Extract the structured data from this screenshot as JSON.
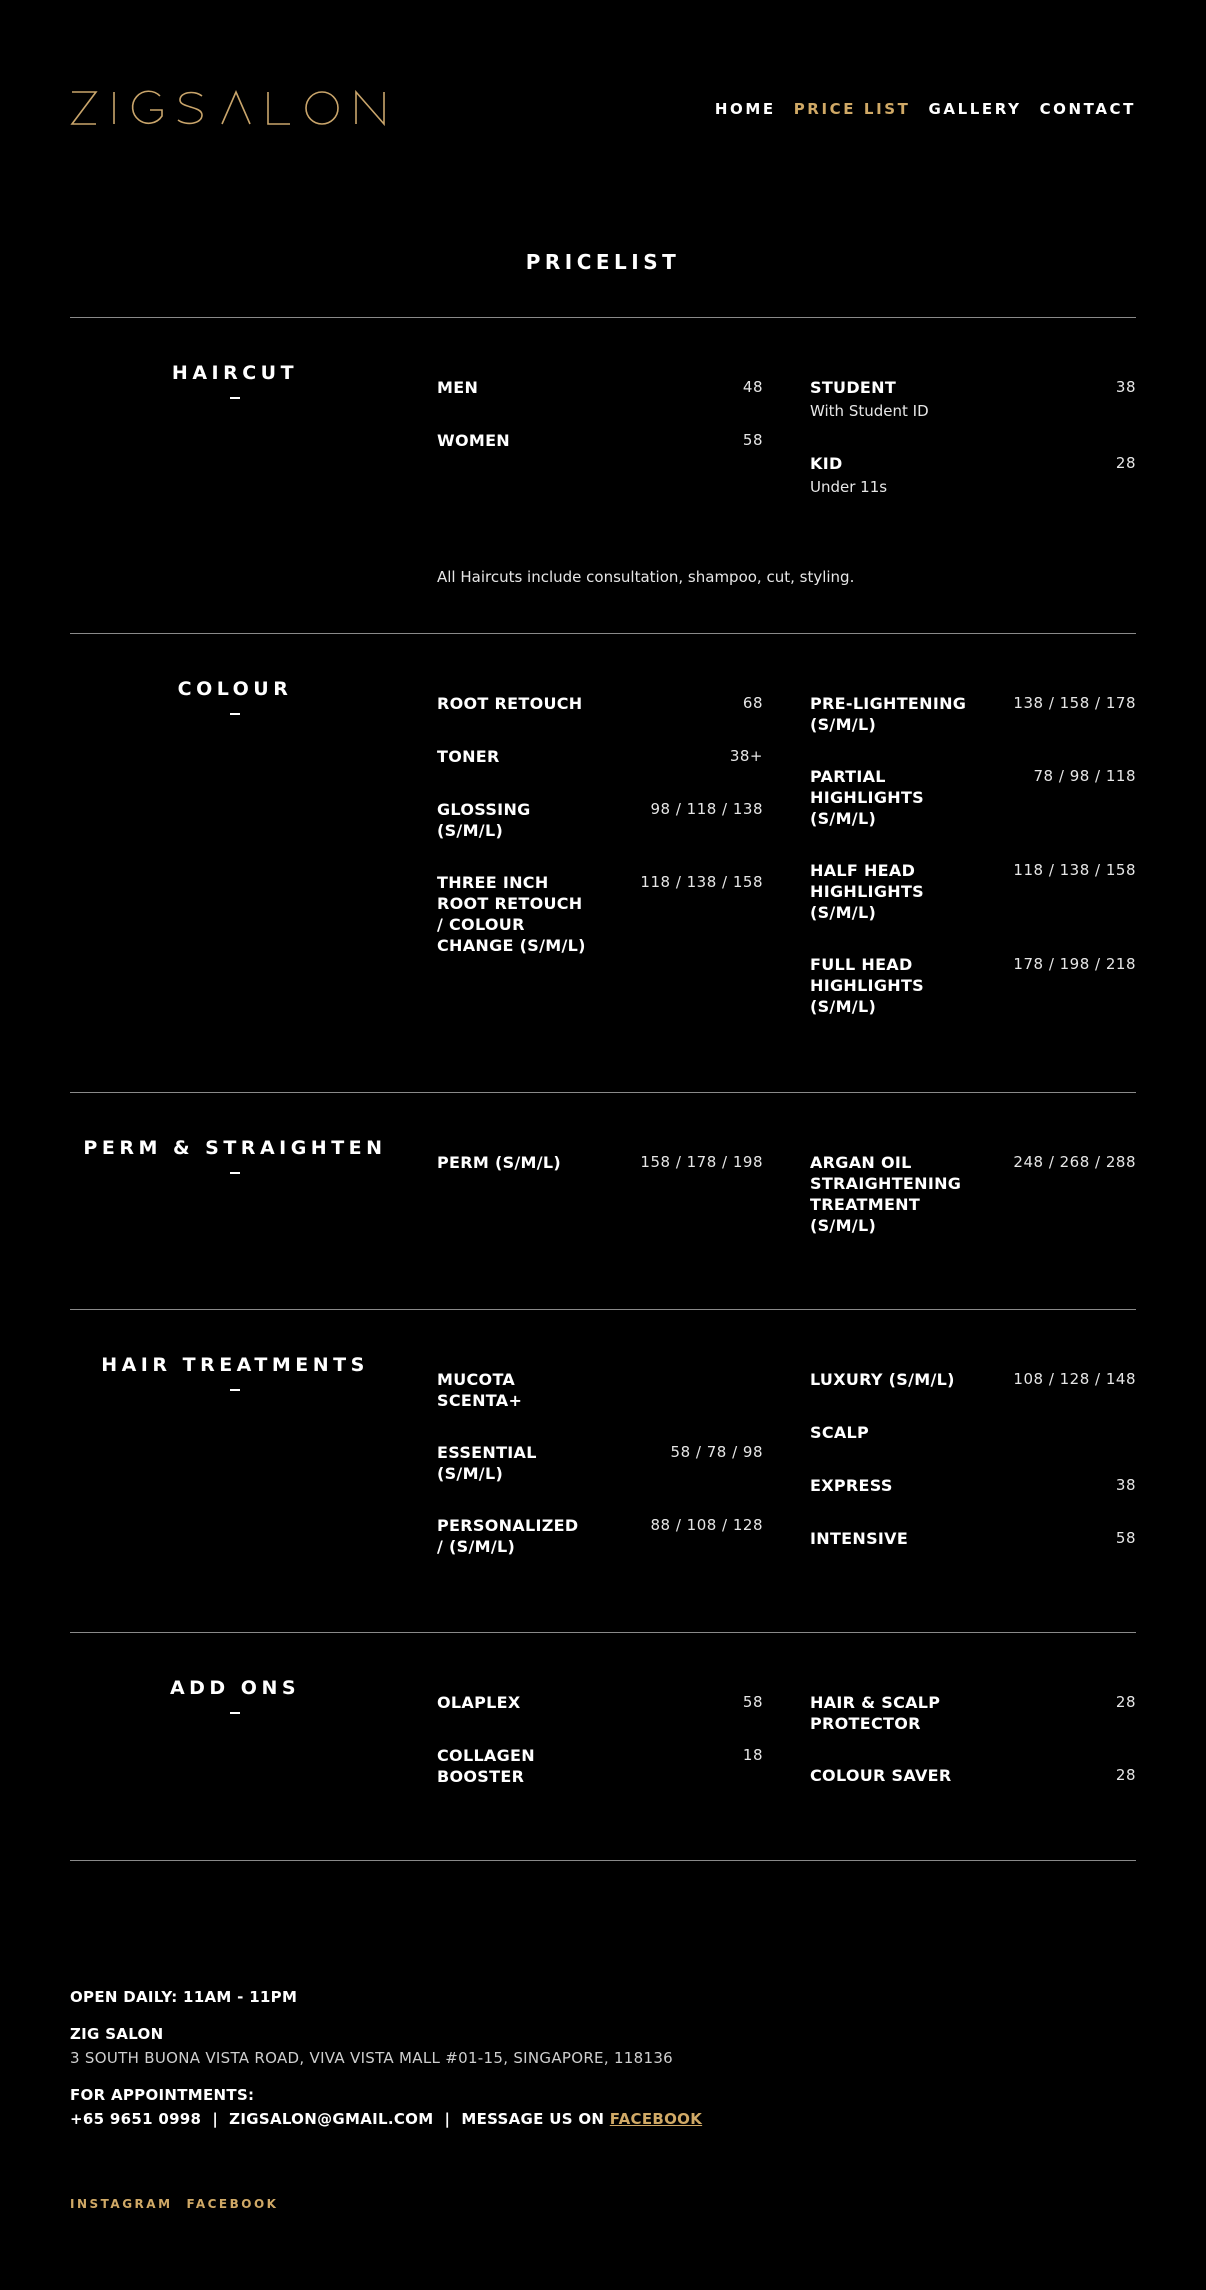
{
  "brand": {
    "logo_text": "ZIGSALON",
    "accent_color": "#d0a966"
  },
  "nav": {
    "items": [
      {
        "label": "HOME",
        "active": false
      },
      {
        "label": "PRICE LIST",
        "active": true
      },
      {
        "label": "GALLERY",
        "active": false
      },
      {
        "label": "CONTACT",
        "active": false
      }
    ]
  },
  "page": {
    "title": "PRICELIST"
  },
  "haircut": {
    "title": "HAIRCUT",
    "left": [
      {
        "name": "MEN",
        "price": "48"
      },
      {
        "name": "WOMEN",
        "price": "58"
      }
    ],
    "right": [
      {
        "name": "STUDENT",
        "price": "38",
        "sub": "With Student ID"
      },
      {
        "name": "KID",
        "price": "28",
        "sub": "Under 11s"
      }
    ],
    "note": "All Haircuts include consultation, shampoo, cut, styling."
  },
  "colour": {
    "title": "COLOUR",
    "left": [
      {
        "name": "ROOT RETOUCH",
        "price": "68"
      },
      {
        "name": "TONER",
        "price": "38+"
      },
      {
        "name": "GLOSSING\n(S/M/L)",
        "price": "98 / 118 / 138"
      },
      {
        "name": "THREE INCH\nROOT RETOUCH\n/ COLOUR\nCHANGE (S/M/L)",
        "price": "118 / 138 / 158"
      }
    ],
    "right": [
      {
        "name": "PRE-LIGHTENING\n(S/M/L)",
        "price": "138 / 158 / 178"
      },
      {
        "name": "PARTIAL\nHIGHLIGHTS\n(S/M/L)",
        "price": "78 / 98 / 118"
      },
      {
        "name": "HALF HEAD\nHIGHLIGHTS\n(S/M/L)",
        "price": "118 / 138 / 158"
      },
      {
        "name": "FULL HEAD\nHIGHLIGHTS\n(S/M/L)",
        "price": "178 / 198 / 218"
      }
    ]
  },
  "perm": {
    "title": "PERM & STRAIGHTEN",
    "left": [
      {
        "name": "PERM (S/M/L)",
        "price": "158 / 178 / 198"
      }
    ],
    "right": [
      {
        "name": "ARGAN OIL\nSTRAIGHTENING\nTREATMENT\n(S/M/L)",
        "price": "248 / 268 / 288"
      }
    ]
  },
  "treatments": {
    "title": "HAIR TREATMENTS",
    "left": [
      {
        "name": "MUCOTA\nSCENTA+",
        "price": ""
      },
      {
        "name": "ESSENTIAL\n(S/M/L)",
        "price": "58 / 78 / 98"
      },
      {
        "name": "PERSONALIZED\n/ (S/M/L)",
        "price": "88 / 108 / 128"
      }
    ],
    "right": [
      {
        "name": "LUXURY (S/M/L)",
        "price": "108 / 128 / 148"
      },
      {
        "name": "SCALP",
        "price": ""
      },
      {
        "name": "EXPRESS",
        "price": "38"
      },
      {
        "name": "INTENSIVE",
        "price": "58"
      }
    ]
  },
  "addons": {
    "title": "ADD ONS",
    "left": [
      {
        "name": "OLAPLEX",
        "price": "58"
      },
      {
        "name": "COLLAGEN\nBOOSTER",
        "price": "18"
      }
    ],
    "right": [
      {
        "name": "HAIR & SCALP\nPROTECTOR",
        "price": "28"
      },
      {
        "name": "COLOUR SAVER",
        "price": "28"
      }
    ]
  },
  "footer": {
    "hours": "OPEN DAILY: 11AM - 11PM",
    "name": "ZIG SALON",
    "address": "3 SOUTH BUONA VISTA ROAD, VIVA VISTA MALL #01-15, SINGAPORE, 118136",
    "appointments_label": "FOR APPOINTMENTS:",
    "phone": "+65 9651 0998",
    "separator": "|",
    "email": "ZIGSALON@GMAIL.COM",
    "message_prefix": "MESSAGE US ON",
    "facebook_link": "FACEBOOK"
  },
  "social": {
    "instagram": "INSTAGRAM",
    "facebook": "FACEBOOK"
  }
}
